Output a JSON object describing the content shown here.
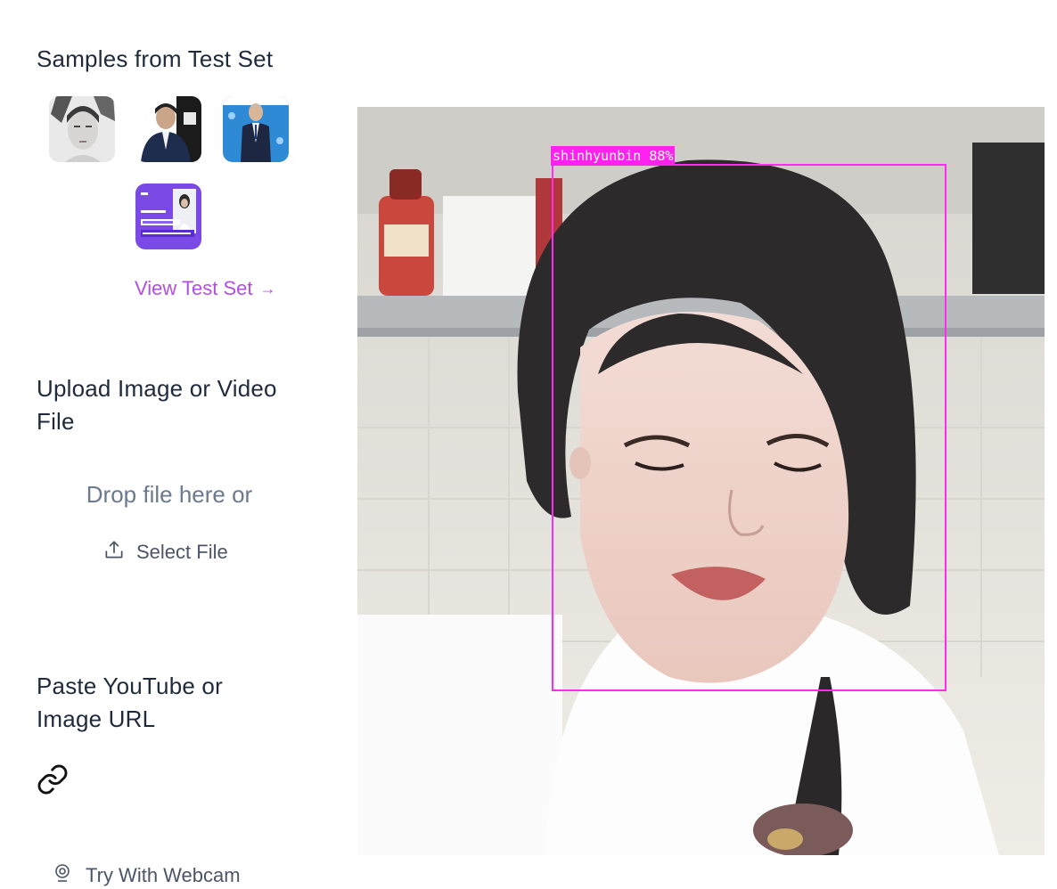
{
  "samples": {
    "title": "Samples from Test Set",
    "thumbnails": [
      {
        "name": "sample-thumbnail-1",
        "icon": "portrait-bw"
      },
      {
        "name": "sample-thumbnail-2",
        "icon": "person-at-event"
      },
      {
        "name": "sample-thumbnail-3",
        "icon": "person-in-suit-blue-backdrop"
      },
      {
        "name": "sample-thumbnail-4",
        "icon": "news-graphic-purple"
      }
    ],
    "view_test_set": "View Test Set",
    "view_arrow": "→"
  },
  "upload": {
    "title": "Upload Image or Video File",
    "drop_text": "Drop file here or",
    "select_file": "Select File",
    "select_icon": "upload-icon"
  },
  "url": {
    "title": "Paste YouTube or Image URL",
    "link_icon": "link-icon"
  },
  "webcam": {
    "label": "Try With Webcam",
    "icon": "webcam-icon"
  },
  "result": {
    "detection_label": "shinhyunbin 88%",
    "box_color": "#ff22ee"
  },
  "colors": {
    "accent": "#b34ee5",
    "heading": "#1f2a3c",
    "muted": "#6b7a8f"
  }
}
